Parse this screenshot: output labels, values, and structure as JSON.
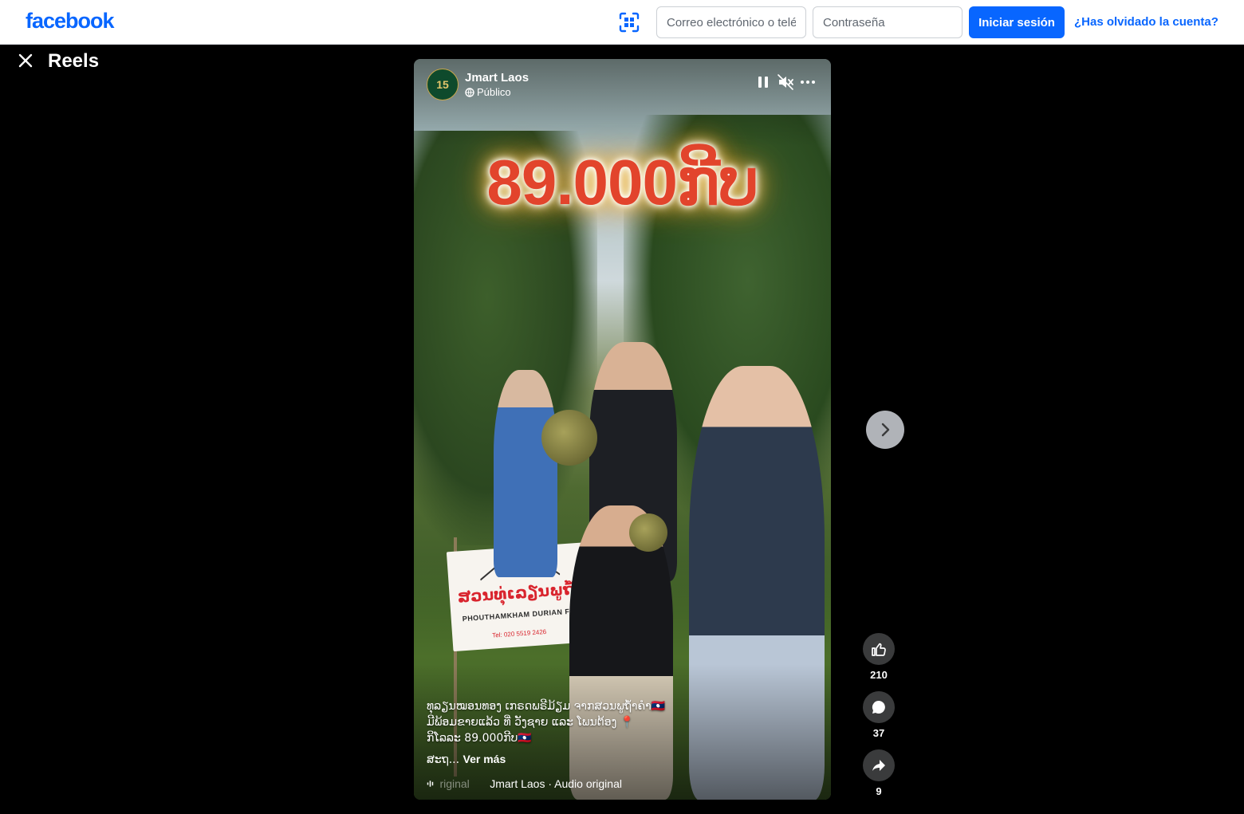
{
  "header": {
    "logo": "facebook",
    "email_placeholder": "Correo electrónico o teléfono",
    "password_placeholder": "Contraseña",
    "login_label": "Iniciar sesión",
    "forgot_label": "¿Has olvidado la cuenta?",
    "scan_icon": "qr-scan-icon"
  },
  "reels": {
    "title": "Reels",
    "close_icon": "close-icon"
  },
  "video": {
    "author": "Jmart Laos",
    "avatar_text": "15",
    "privacy": "Público",
    "overlay_price": "89.000ກີບ",
    "sign_lao": "ສວນທຸ່ເລຽນພູຖ້ຳ",
    "sign_en": "PHOUTHAMKHAM DURIAN FARM",
    "sign_tel": "Tel: 020 5519 2426",
    "caption_lines": [
      "ທຸລຽນໝອນທອງ ເກຣດພຣີມ້ຽມ ຈາກສວນພູຖ້ຳຄຳ🇱🇦",
      "ມີພ້ອມຂາຍແລ້ວ ທີ່ ວັງຊາຍ ແລະ ໂພນຕ້ອງ 📍",
      "ກິໂລລະ 89.000ກີບ🇱🇦"
    ],
    "caption_tail": "ສະຖ...",
    "see_more": "Ver más",
    "audio_dim": "riginal",
    "audio_text": "Jmart Laos · Audio original"
  },
  "actions": {
    "likes": "210",
    "comments": "37",
    "shares": "9"
  },
  "colors": {
    "brand": "#0866ff",
    "price_text": "#e2442c",
    "action_bg": "#3a3b3c"
  }
}
